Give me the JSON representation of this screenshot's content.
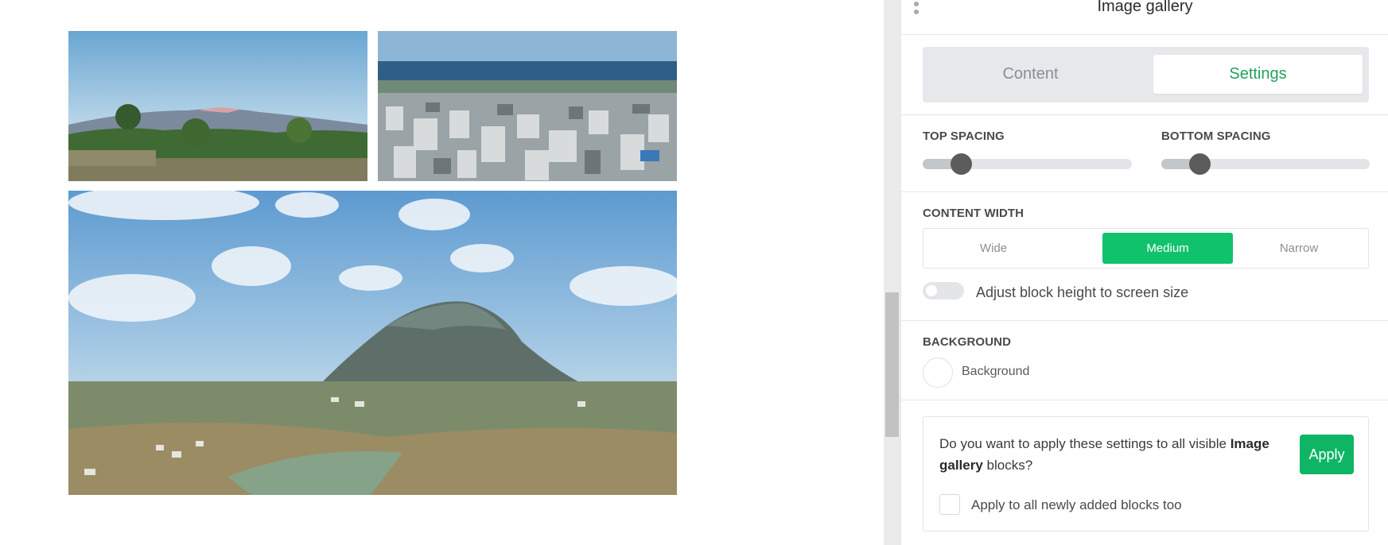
{
  "panel": {
    "title": "Image gallery",
    "tabs": [
      {
        "label": "Content",
        "active": false
      },
      {
        "label": "Settings",
        "active": true
      }
    ],
    "spacing": {
      "top_label": "TOP SPACING",
      "top_value": 0.15,
      "bottom_label": "BOTTOM SPACING",
      "bottom_value": 0.15
    },
    "content_width": {
      "label": "CONTENT WIDTH",
      "options": [
        "Wide",
        "Medium",
        "Narrow"
      ],
      "selected": "Medium"
    },
    "adjust_height": {
      "label": "Adjust block height to screen size",
      "enabled": false
    },
    "background": {
      "section_label": "BACKGROUND",
      "label": "Background",
      "color": "#ffffff"
    },
    "apply": {
      "text_before": "Do you want to apply these settings to all visible ",
      "text_bold": "Image gallery",
      "text_after": " blocks?",
      "button_label": "Apply",
      "checkbox_label": "Apply to all newly added blocks too",
      "checkbox_checked": false
    }
  },
  "colors": {
    "accent_green": "#0fc26b",
    "tab_active_text": "#1fa35b"
  },
  "icons": {
    "drag_handle": "drag-handle-icon"
  }
}
